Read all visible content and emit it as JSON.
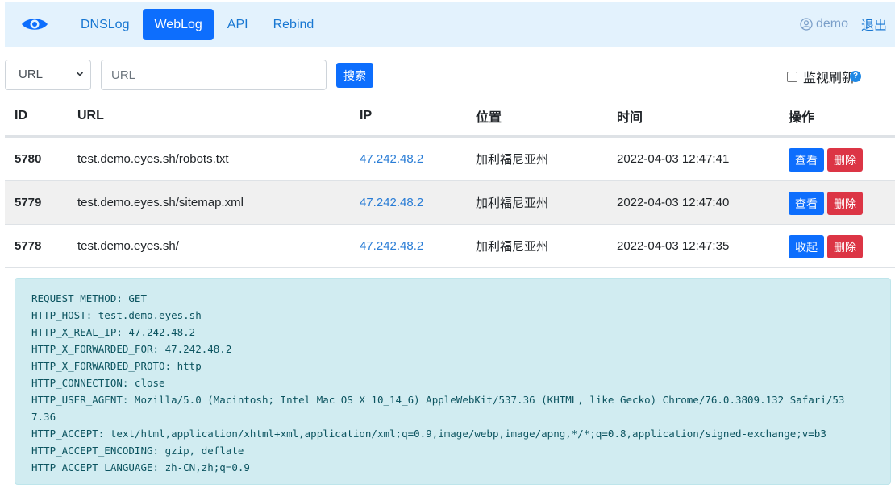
{
  "nav": {
    "items": [
      {
        "label": "DNSLog",
        "active": false
      },
      {
        "label": "WebLog",
        "active": true
      },
      {
        "label": "API",
        "active": false
      },
      {
        "label": "Rebind",
        "active": false
      }
    ],
    "user": "demo",
    "logout": "退出",
    "logo_icon": "eye-icon"
  },
  "search": {
    "field_selected": "URL",
    "placeholder": "URL",
    "value": "",
    "button": "搜索",
    "monitor_label": "监视刷新",
    "monitor_checked": false,
    "help_icon": "question-icon"
  },
  "table": {
    "headers": [
      "ID",
      "URL",
      "IP",
      "位置",
      "时间",
      "操作"
    ],
    "rows": [
      {
        "id": "5780",
        "url": "test.demo.eyes.sh/robots.txt",
        "ip": "47.242.48.2",
        "location": "加利福尼亚州",
        "time": "2022-04-03 12:47:41",
        "view": "查看",
        "delete": "删除"
      },
      {
        "id": "5779",
        "url": "test.demo.eyes.sh/sitemap.xml",
        "ip": "47.242.48.2",
        "location": "加利福尼亚州",
        "time": "2022-04-03 12:47:40",
        "view": "查看",
        "delete": "删除"
      },
      {
        "id": "5778",
        "url": "test.demo.eyes.sh/",
        "ip": "47.242.48.2",
        "location": "加利福尼亚州",
        "time": "2022-04-03 12:47:35",
        "view": "收起",
        "delete": "删除"
      }
    ]
  },
  "detail": {
    "lines": [
      "REQUEST_METHOD: GET",
      "HTTP_HOST: test.demo.eyes.sh",
      "HTTP_X_REAL_IP: 47.242.48.2",
      "HTTP_X_FORWARDED_FOR: 47.242.48.2",
      "HTTP_X_FORWARDED_PROTO: http",
      "HTTP_CONNECTION: close",
      "HTTP_USER_AGENT: Mozilla/5.0 (Macintosh; Intel Mac OS X 10_14_6) AppleWebKit/537.36 (KHTML, like Gecko) Chrome/76.0.3809.132 Safari/53",
      "7.36",
      "HTTP_ACCEPT: text/html,application/xhtml+xml,application/xml;q=0.9,image/webp,image/apng,*/*;q=0.8,application/signed-exchange;v=b3",
      "HTTP_ACCEPT_ENCODING: gzip, deflate",
      "HTTP_ACCEPT_LANGUAGE: zh-CN,zh;q=0.9"
    ]
  },
  "colors": {
    "primary": "#0d6efd",
    "danger": "#dc3545",
    "navbar_bg": "#e3f2fd",
    "link": "#2a7dd6",
    "info_bg": "#d1ecf1"
  }
}
